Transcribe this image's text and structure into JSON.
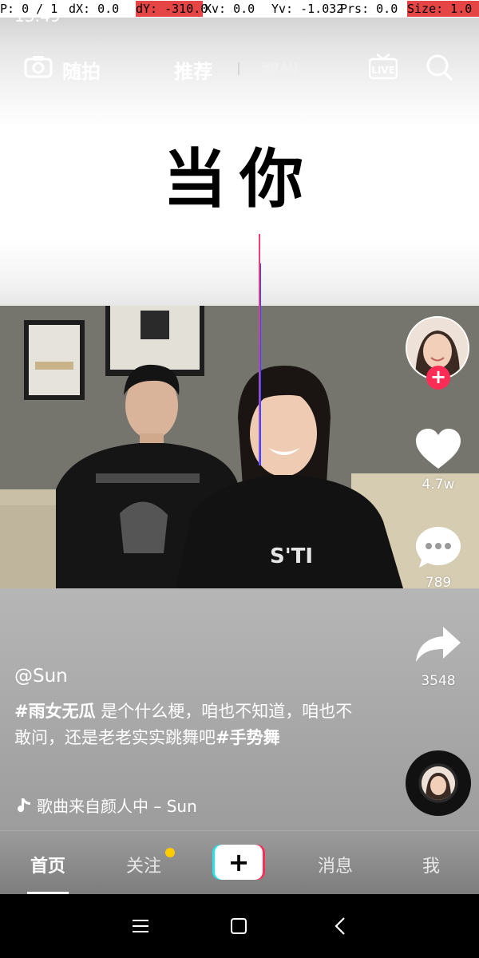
{
  "debug": {
    "pointer": "P: 0 / 1",
    "dx": "dX: 0.0",
    "dy": "dY: -310.0",
    "xv": "Xv: 0.0",
    "yv": "Yv: -1.032",
    "prs": "Prs: 0.0",
    "size": "Size: 1.0"
  },
  "status": {
    "time": "13:49"
  },
  "topnav": {
    "camera_label": "随拍",
    "tab_recommend": "推荐",
    "tab_city": "郑州",
    "live_icon": "live-icon",
    "search_icon": "search-icon"
  },
  "video": {
    "caption": "当你"
  },
  "actions": {
    "likes": "4.7w",
    "comments": "789",
    "shares": "3548"
  },
  "post": {
    "username": "@Sun",
    "hashtag1": "#雨女无瓜",
    "text": " 是个什么梗，咱也不知道，咱也不敢问，还是老老实实跳舞吧",
    "hashtag2": "#手势舞",
    "music": "歌曲来自颜人中 – Sun"
  },
  "tabbar": {
    "home": "首页",
    "follow": "关注",
    "messages": "消息",
    "me": "我",
    "create": "+"
  },
  "colors": {
    "accent": "#ff2c55",
    "cyan": "#29e3e8",
    "notify": "#ffcc00"
  }
}
